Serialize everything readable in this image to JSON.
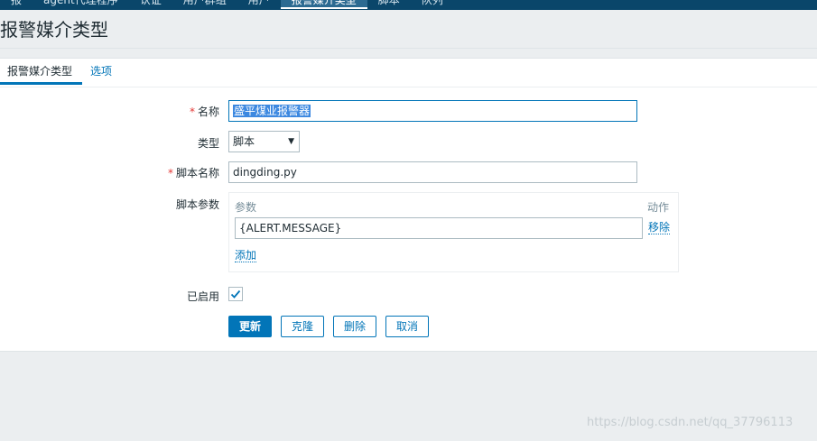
{
  "nav": {
    "items": [
      "报",
      "agent代理程序",
      "认证",
      "用户群组",
      "用户",
      "报警媒介类型",
      "脚本",
      "队列"
    ],
    "active_index": 5
  },
  "page": {
    "title": "报警媒介类型"
  },
  "tabs": [
    {
      "label": "报警媒介类型",
      "active": true
    },
    {
      "label": "选项",
      "active": false
    }
  ],
  "form": {
    "name": {
      "label": "名称",
      "required_mark": "*",
      "value": "盛平煤业报警器"
    },
    "type": {
      "label": "类型",
      "value": "脚本",
      "arrow": "▼"
    },
    "script_name": {
      "label": "脚本名称",
      "required_mark": "*",
      "value": "dingding.py"
    },
    "script_params": {
      "label": "脚本参数",
      "col_param": "参数",
      "col_action": "动作",
      "rows": [
        {
          "value": "{ALERT.MESSAGE}",
          "remove": "移除"
        }
      ],
      "add": "添加"
    },
    "enabled": {
      "label": "已启用",
      "checked": true
    }
  },
  "buttons": {
    "update": "更新",
    "clone": "克隆",
    "delete": "删除",
    "cancel": "取消"
  },
  "watermark": "https://blog.csdn.net/qq_37796113"
}
